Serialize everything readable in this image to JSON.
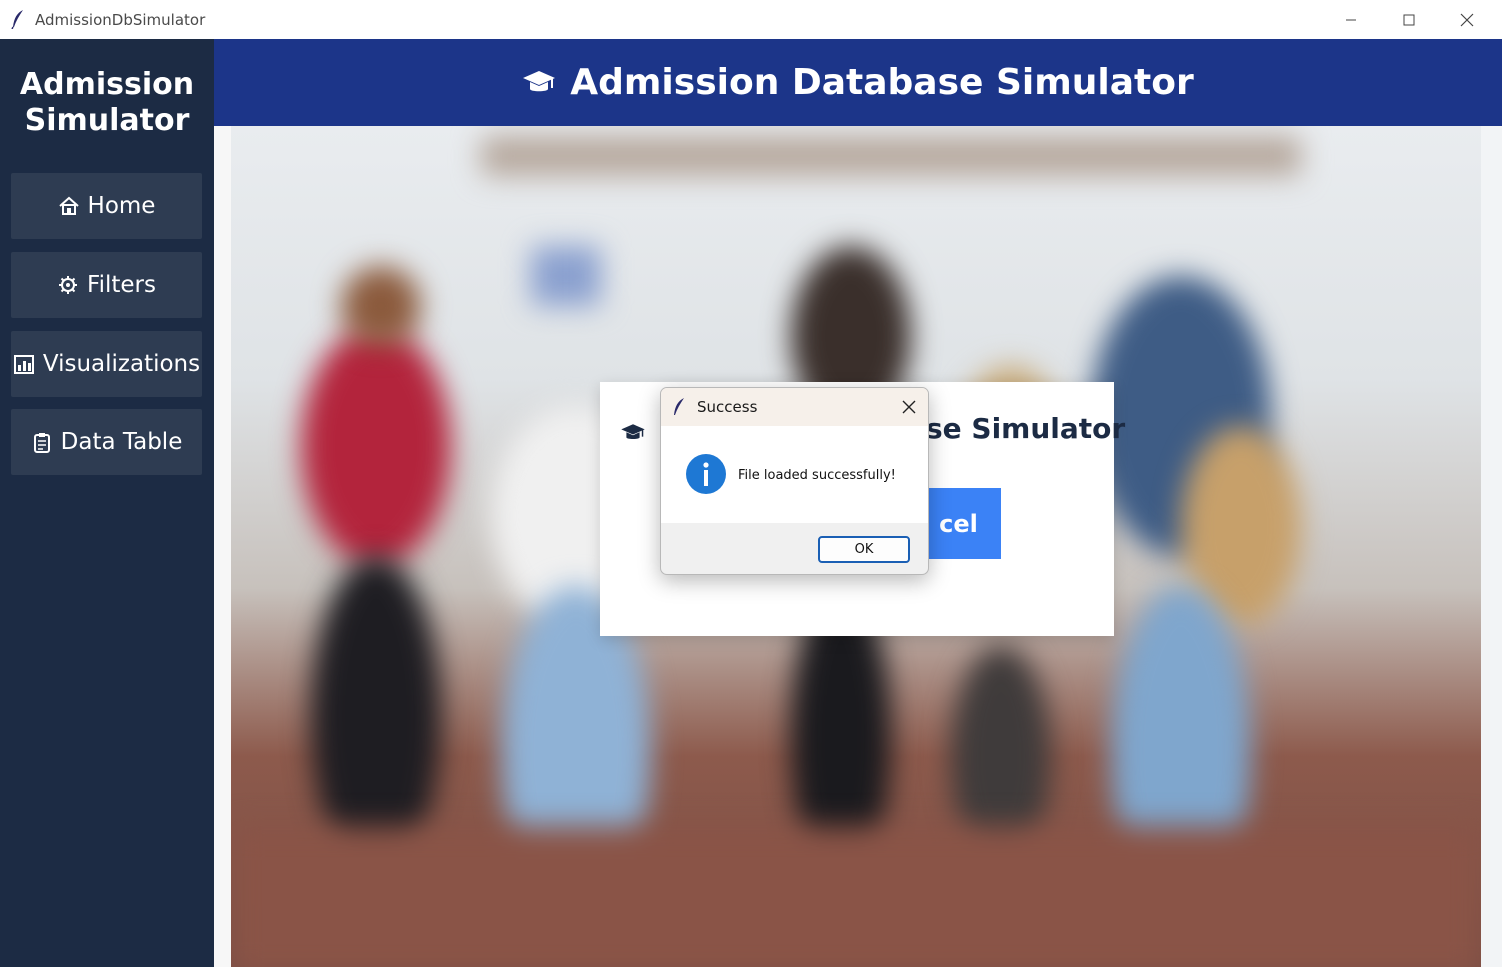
{
  "window": {
    "title": "AdmissionDbSimulator",
    "controls": [
      "minimize-icon",
      "maximize-icon",
      "close-icon"
    ]
  },
  "sidebar": {
    "brand": "Admission\nSimulator",
    "brand_line1": "Admission",
    "brand_line2": "Simulator",
    "items": [
      {
        "label": "Home",
        "icon": "home-icon"
      },
      {
        "label": "Filters",
        "icon": "gear-icon"
      },
      {
        "label": "Visualizations",
        "icon": "bar-chart-icon"
      },
      {
        "label": "Data Table",
        "icon": "clipboard-icon"
      }
    ]
  },
  "header": {
    "title": "Admission Database Simulator",
    "icon": "graduation-cap-icon"
  },
  "card": {
    "title_visible": "se Simulator",
    "button_label_visible": "cel"
  },
  "dialog": {
    "title": "Success",
    "message": "File loaded successfully!",
    "ok_label": "OK",
    "icon": "info-icon"
  },
  "colors": {
    "sidebar_bg": "#1c2b44",
    "nav_button_bg": "#2e3c52",
    "header_bg": "#1c3589",
    "accent_button": "#3b82f6",
    "info_blue": "#1e78d4"
  }
}
